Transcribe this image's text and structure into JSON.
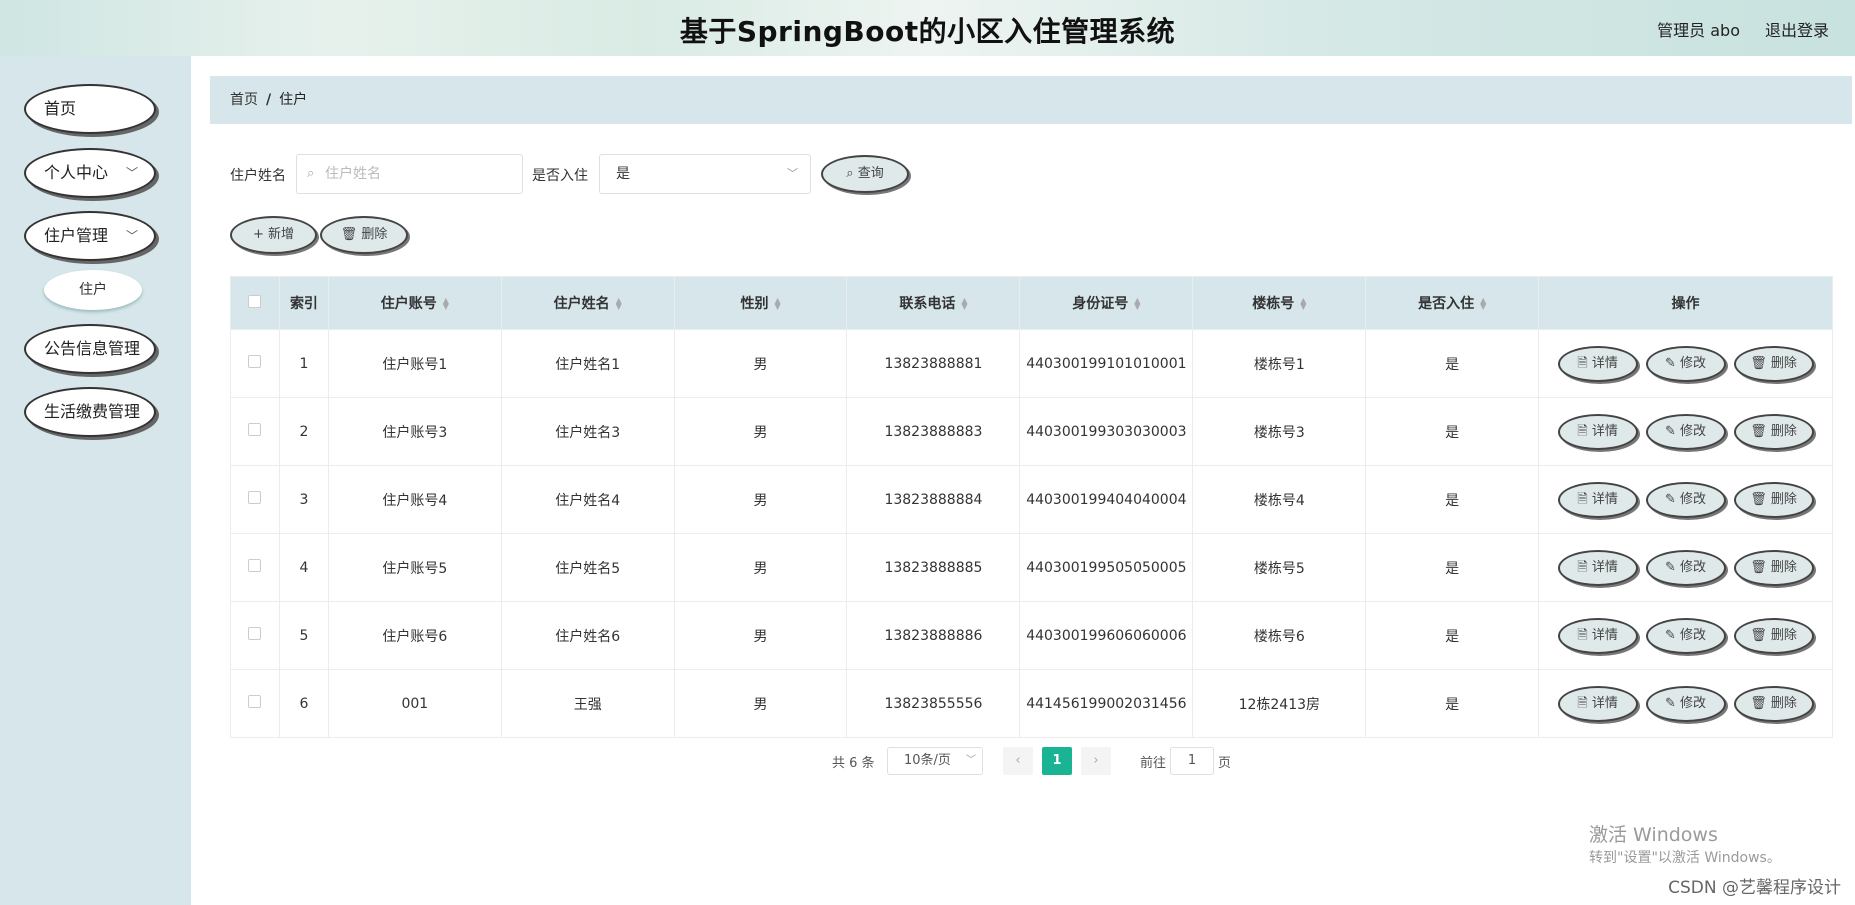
{
  "header": {
    "title": "基于SpringBoot的小区入住管理系统",
    "user": "管理员 abo",
    "logout": "退出登录"
  },
  "sidebar": {
    "items": [
      {
        "label": "首页"
      },
      {
        "label": "个人中心"
      },
      {
        "label": "住户管理"
      },
      {
        "label": "公告信息管理"
      },
      {
        "label": "生活缴费管理"
      }
    ],
    "sub_item": "住户"
  },
  "breadcrumb": {
    "home": "首页",
    "sep": "/",
    "current": "住户"
  },
  "search": {
    "name_label": "住户姓名",
    "name_placeholder": "住户姓名",
    "resident_label": "是否入住",
    "resident_value": "是",
    "query_button": "查询"
  },
  "actions": {
    "add": "新增",
    "delete": "删除"
  },
  "table": {
    "headers": {
      "index": "索引",
      "account": "住户账号",
      "name": "住户姓名",
      "gender": "性别",
      "phone": "联系电话",
      "idcard": "身份证号",
      "building": "楼栋号",
      "resident": "是否入住",
      "ops": "操作"
    },
    "ops": {
      "detail": "详情",
      "edit": "修改",
      "delete": "删除"
    },
    "rows": [
      {
        "index": "1",
        "account": "住户账号1",
        "name": "住户姓名1",
        "gender": "男",
        "phone": "13823888881",
        "idcard": "440300199101010001",
        "building": "楼栋号1",
        "resident": "是"
      },
      {
        "index": "2",
        "account": "住户账号3",
        "name": "住户姓名3",
        "gender": "男",
        "phone": "13823888883",
        "idcard": "440300199303030003",
        "building": "楼栋号3",
        "resident": "是"
      },
      {
        "index": "3",
        "account": "住户账号4",
        "name": "住户姓名4",
        "gender": "男",
        "phone": "13823888884",
        "idcard": "440300199404040004",
        "building": "楼栋号4",
        "resident": "是"
      },
      {
        "index": "4",
        "account": "住户账号5",
        "name": "住户姓名5",
        "gender": "男",
        "phone": "13823888885",
        "idcard": "440300199505050005",
        "building": "楼栋号5",
        "resident": "是"
      },
      {
        "index": "5",
        "account": "住户账号6",
        "name": "住户姓名6",
        "gender": "男",
        "phone": "13823888886",
        "idcard": "440300199606060006",
        "building": "楼栋号6",
        "resident": "是"
      },
      {
        "index": "6",
        "account": "001",
        "name": "王强",
        "gender": "男",
        "phone": "13823855556",
        "idcard": "441456199002031456",
        "building": "12栋2413房",
        "resident": "是"
      }
    ]
  },
  "pagination": {
    "total": "共 6 条",
    "page_size": "10条/页",
    "current_page": "1",
    "goto_label": "前往",
    "goto_value": "1",
    "page_suffix": "页"
  },
  "watermark": {
    "line1": "激活 Windows",
    "line2": "转到\"设置\"以激活 Windows。",
    "csdn": "CSDN @艺馨程序设计"
  },
  "colors": {
    "accent": "#1ab394",
    "panel": "#d6e6ea"
  }
}
